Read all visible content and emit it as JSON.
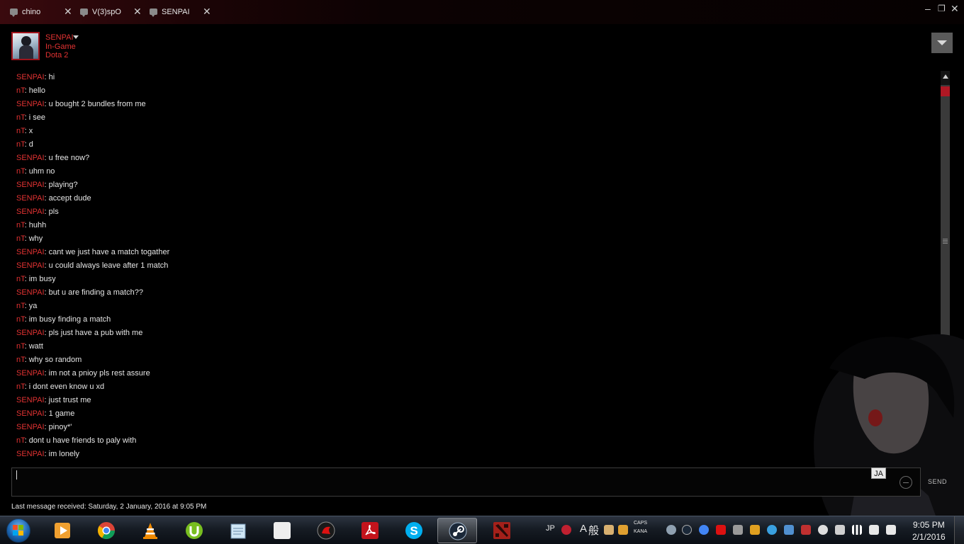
{
  "tabs": [
    {
      "label": "chino",
      "close": "✕"
    },
    {
      "label": "V(3)spO",
      "close": "✕"
    },
    {
      "label": "SENPAI",
      "close": "✕"
    }
  ],
  "window_controls": {
    "minimize": "–",
    "maximize": "❐",
    "close": "✕"
  },
  "friend": {
    "name": "SENPAI",
    "status": "In-Game",
    "game": "Dota 2"
  },
  "messages": [
    {
      "sender": "SENPAI",
      "text": ": hi"
    },
    {
      "sender": "nT",
      "text": ": hello"
    },
    {
      "sender": "SENPAI",
      "text": ": u bought 2 bundles from me"
    },
    {
      "sender": "nT",
      "text": ": i see"
    },
    {
      "sender": "nT",
      "text": ": x"
    },
    {
      "sender": "nT",
      "text": ": d"
    },
    {
      "sender": "SENPAI",
      "text": ": u free now?"
    },
    {
      "sender": "nT",
      "text": ": uhm no"
    },
    {
      "sender": "SENPAI",
      "text": ": playing?"
    },
    {
      "sender": "SENPAI",
      "text": ": accept dude"
    },
    {
      "sender": "SENPAI",
      "text": ": pls"
    },
    {
      "sender": "nT",
      "text": ": huhh"
    },
    {
      "sender": "nT",
      "text": ": why"
    },
    {
      "sender": "SENPAI",
      "text": ": cant we just have a match togather"
    },
    {
      "sender": "SENPAI",
      "text": ": u could always leave after 1 match"
    },
    {
      "sender": "nT",
      "text": ": im busy"
    },
    {
      "sender": "SENPAI",
      "text": ": but u are finding a match??"
    },
    {
      "sender": "nT",
      "text": ": ya"
    },
    {
      "sender": "nT",
      "text": ": im busy finding a match"
    },
    {
      "sender": "SENPAI",
      "text": ": pls just have a pub with me"
    },
    {
      "sender": "nT",
      "text": ": watt"
    },
    {
      "sender": "nT",
      "text": ": why so random"
    },
    {
      "sender": "SENPAI",
      "text": ": im not a pnioy pls rest assure"
    },
    {
      "sender": "nT",
      "text": ": i dont even know u xd"
    },
    {
      "sender": "SENPAI",
      "text": ": just trust me"
    },
    {
      "sender": "SENPAI",
      "text": ": 1 game"
    },
    {
      "sender": "SENPAI",
      "text": ": pinoy*'"
    },
    {
      "sender": "nT",
      "text": ": dont u have friends to paly with"
    },
    {
      "sender": "SENPAI",
      "text": ": im lonely"
    }
  ],
  "input": {
    "value": "",
    "ime_badge": "JA",
    "send_label": "SEND"
  },
  "last_received": "Last message received: Saturday, 2 January, 2016 at 9:05 PM",
  "taskbar": {
    "apps": [
      "start-orb",
      "media-player",
      "chrome",
      "vlc",
      "utorrent",
      "notepad",
      "moon-app",
      "dragon-app",
      "acrobat",
      "skype",
      "steam",
      "dota2"
    ],
    "language": "JP",
    "caps_label": "CAPS",
    "kana_label": "KANA",
    "ime_a": "A",
    "ime_kanji": "般",
    "clock_time": "9:05 PM",
    "clock_date": "2/1/2016"
  },
  "colors": {
    "accent": "#e23232",
    "background": "#000000",
    "text": "#e6e6e6"
  }
}
